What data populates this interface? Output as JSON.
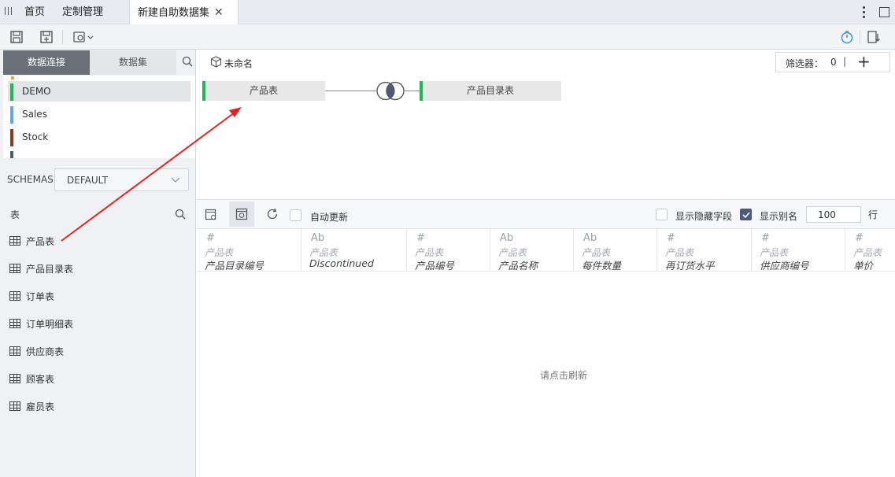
{
  "tabs": {
    "home": "首页",
    "custom": "定制管理",
    "active": "新建自助数据集",
    "close_icon": "close-icon"
  },
  "left_panel": {
    "tab_connection": "数据连接",
    "tab_dataset": "数据集",
    "connections": [
      {
        "label": "DEMO",
        "color": "#1db954"
      },
      {
        "label": "Sales",
        "color": "#5aa9f0"
      },
      {
        "label": "Stock",
        "color": "#8b3a1a"
      }
    ],
    "schemas_label": "SCHEMAS",
    "schema_value": "DEFAULT",
    "tables_label": "表",
    "tables": [
      "产品表",
      "产品目录表",
      "订单表",
      "订单明细表",
      "供应商表",
      "顾客表",
      "雇员表"
    ]
  },
  "canvas": {
    "dataset_name": "未命名",
    "filter_label": "筛选器：",
    "filter_count": "0",
    "filter_sep": "|",
    "add_symbol": "+",
    "node_left": "产品表",
    "node_right": "产品目录表",
    "join_color": "#4a5a82"
  },
  "preview": {
    "auto_update": "自动更新",
    "show_hidden": "显示隐藏字段",
    "show_alias": "显示别名",
    "rows_value": "100",
    "rows_unit": "行",
    "empty_text": "请点击刷新",
    "columns": [
      {
        "type": "#",
        "table": "产品表",
        "field": "产品目录编号"
      },
      {
        "type": "Ab",
        "table": "产品表",
        "field": "Discontinued"
      },
      {
        "type": "#",
        "table": "产品表",
        "field": "产品编号"
      },
      {
        "type": "Ab",
        "table": "产品表",
        "field": "产品名称"
      },
      {
        "type": "Ab",
        "table": "产品表",
        "field": "每件数量"
      },
      {
        "type": "#",
        "table": "产品表",
        "field": "再订货水平"
      },
      {
        "type": "#",
        "table": "产品表",
        "field": "供应商编号"
      },
      {
        "type": "#",
        "table": "产品表",
        "field": "单价"
      }
    ]
  }
}
